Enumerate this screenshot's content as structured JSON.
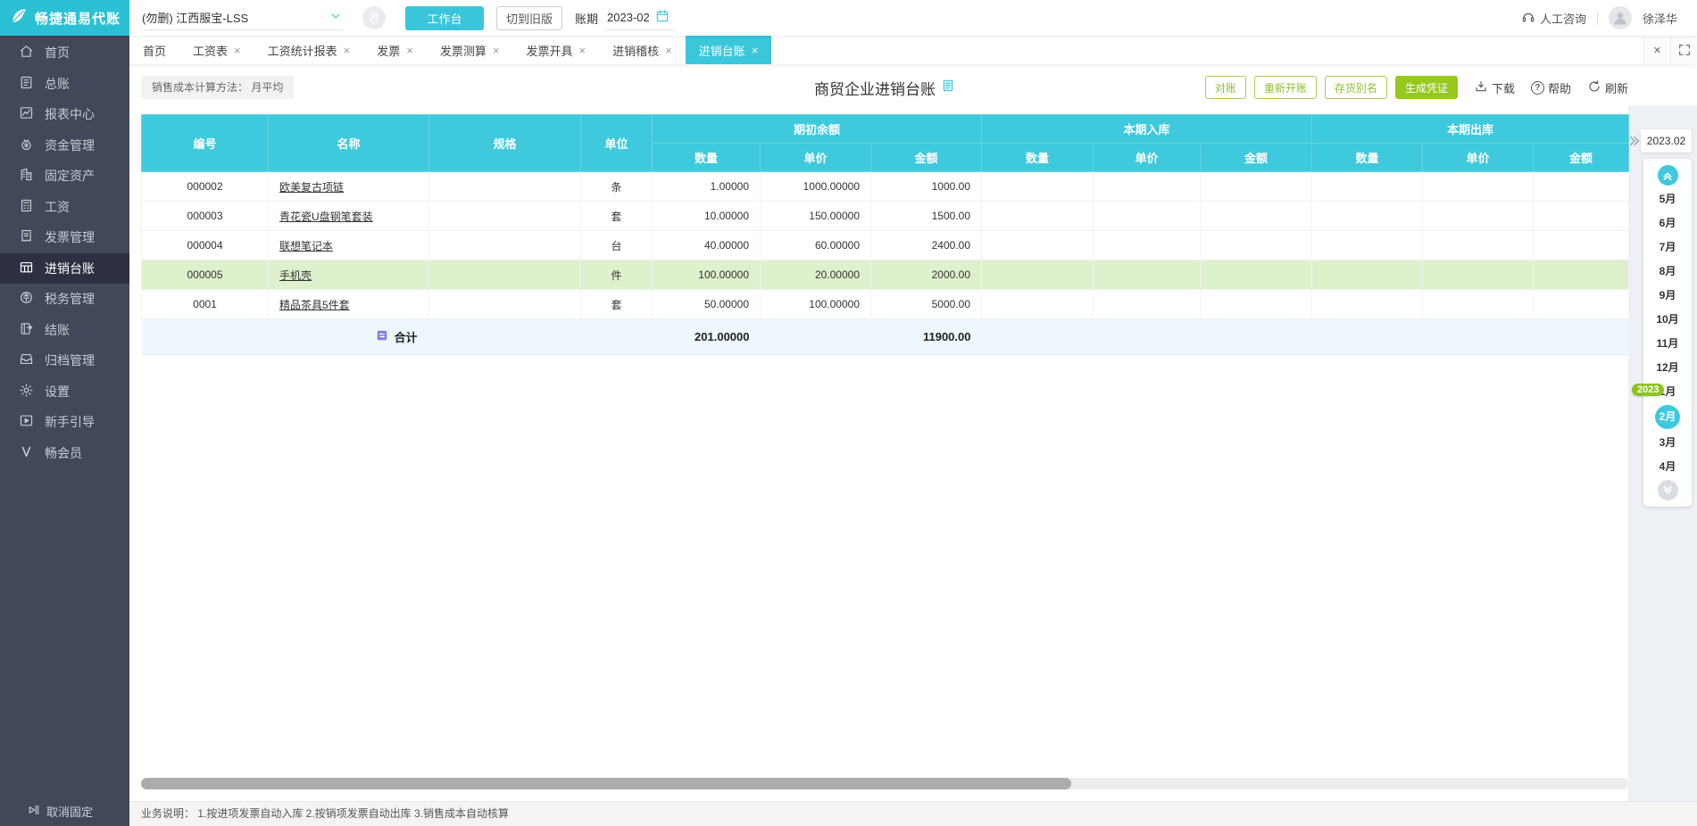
{
  "colors": {
    "accent": "#3bc6da",
    "green": "#97c81e",
    "green_outline": "#8fbf2f",
    "row_highlight": "#def0cc",
    "sidebar_bg": "#424759",
    "sidebar_active": "#2d3040",
    "table_header": "#3ec9dd",
    "total_row_bg": "#edf7fc",
    "year_badge": "#8fc321",
    "total_icon_purple": "#8a7be6"
  },
  "brand": {
    "name": "畅捷通易代账",
    "logo_icon": "feather-logo-icon"
  },
  "topbar": {
    "company_selector": "(勿删) 江西服宝-LSS",
    "notepad_icon": "notepad-icon",
    "workbench_button": "工作台",
    "switch_old_button": "切到旧版",
    "period_label": "账期",
    "period_value": "2023-02",
    "calendar_icon": "calendar-icon",
    "consult_label": "人工咨询",
    "headset_icon": "headset-icon",
    "username": "徐泽华"
  },
  "sidebar": {
    "items": [
      {
        "key": "home",
        "label": "首页",
        "icon": "home-icon",
        "active": false
      },
      {
        "key": "general-ledger",
        "label": "总账",
        "icon": "ledger-icon",
        "active": false
      },
      {
        "key": "report-center",
        "label": "报表中心",
        "icon": "report-icon",
        "active": false
      },
      {
        "key": "funds",
        "label": "资金管理",
        "icon": "funds-icon",
        "active": false
      },
      {
        "key": "fixed-assets",
        "label": "固定资产",
        "icon": "asset-icon",
        "active": false
      },
      {
        "key": "salary",
        "label": "工资",
        "icon": "salary-icon",
        "active": false
      },
      {
        "key": "invoice-mgmt",
        "label": "发票管理",
        "icon": "invoice-icon",
        "active": false
      },
      {
        "key": "purchase-sale-ledger",
        "label": "进销台账",
        "icon": "psledger-icon",
        "active": true
      },
      {
        "key": "tax-mgmt",
        "label": "税务管理",
        "icon": "tax-icon",
        "active": false
      },
      {
        "key": "closing",
        "label": "结账",
        "icon": "closing-icon",
        "active": false
      },
      {
        "key": "archive",
        "label": "归档管理",
        "icon": "archive-icon",
        "active": false
      },
      {
        "key": "settings",
        "label": "设置",
        "icon": "settings-icon",
        "active": false
      },
      {
        "key": "guide",
        "label": "新手引导",
        "icon": "guide-icon",
        "active": false
      },
      {
        "key": "member",
        "label": "畅会员",
        "icon": "member-icon",
        "active": false
      }
    ],
    "unpin_label": "取消固定",
    "unpin_icon": "unpin-icon"
  },
  "tabs": [
    {
      "key": "home",
      "label": "首页",
      "closable": false,
      "active": false
    },
    {
      "key": "salary-sheet",
      "label": "工资表",
      "closable": true,
      "active": false
    },
    {
      "key": "salary-report",
      "label": "工资统计报表",
      "closable": true,
      "active": false
    },
    {
      "key": "invoice",
      "label": "发票",
      "closable": true,
      "active": false
    },
    {
      "key": "invoice-calc",
      "label": "发票测算",
      "closable": true,
      "active": false
    },
    {
      "key": "invoice-issue",
      "label": "发票开具",
      "closable": true,
      "active": false
    },
    {
      "key": "purchase-sale-audit",
      "label": "进销稽核",
      "closable": true,
      "active": false
    },
    {
      "key": "purchase-sale-ledger",
      "label": "进销台账",
      "closable": true,
      "active": true
    }
  ],
  "toolbar": {
    "cost_method_label": "销售成本计算方法：",
    "cost_method_value": "月平均",
    "page_title": "商贸企业进销台账",
    "title_icon": "document-icon",
    "buttons": [
      {
        "key": "reconcile",
        "label": "对账",
        "variant": "outline"
      },
      {
        "key": "reopen",
        "label": "重新开账",
        "variant": "outline"
      },
      {
        "key": "stock-alias",
        "label": "存货别名",
        "variant": "outline"
      },
      {
        "key": "make-voucher",
        "label": "生成凭证",
        "variant": "solid"
      }
    ],
    "download_label": "下载",
    "help_label": "帮助",
    "refresh_label": "刷新"
  },
  "table": {
    "fixed_columns": [
      {
        "key": "code",
        "label": "编号"
      },
      {
        "key": "name",
        "label": "名称"
      },
      {
        "key": "spec",
        "label": "规格"
      },
      {
        "key": "unit",
        "label": "单位"
      }
    ],
    "groups": [
      {
        "key": "begin",
        "label": "期初余额",
        "children": [
          "数量",
          "单价",
          "金额"
        ]
      },
      {
        "key": "in",
        "label": "本期入库",
        "children": [
          "数量",
          "单价",
          "金额"
        ]
      },
      {
        "key": "out",
        "label": "本期出库",
        "children": [
          "数量",
          "单价",
          "金额"
        ]
      }
    ],
    "rows": [
      {
        "code": "000002",
        "name": "欧美复古项链",
        "spec": "",
        "unit": "条",
        "begin_qty": "1.00000",
        "begin_price": "1000.00000",
        "begin_amount": "1000.00",
        "in_qty": "",
        "in_price": "",
        "in_amount": "",
        "out_qty": "",
        "out_price": "",
        "out_amount": "",
        "highlight": false
      },
      {
        "code": "000003",
        "name": "青花瓷U盘钢笔套装",
        "spec": "",
        "unit": "套",
        "begin_qty": "10.00000",
        "begin_price": "150.00000",
        "begin_amount": "1500.00",
        "in_qty": "",
        "in_price": "",
        "in_amount": "",
        "out_qty": "",
        "out_price": "",
        "out_amount": "",
        "highlight": false
      },
      {
        "code": "000004",
        "name": "联想笔记本",
        "spec": "",
        "unit": "台",
        "begin_qty": "40.00000",
        "begin_price": "60.00000",
        "begin_amount": "2400.00",
        "in_qty": "",
        "in_price": "",
        "in_amount": "",
        "out_qty": "",
        "out_price": "",
        "out_amount": "",
        "highlight": true
      },
      {
        "code": "0001",
        "name": "精品茶具5件套",
        "spec": "",
        "unit": "套",
        "begin_qty": "50.00000",
        "begin_price": "100.00000",
        "begin_amount": "5000.00",
        "in_qty": "",
        "in_price": "",
        "in_amount": "",
        "out_qty": "",
        "out_price": "",
        "out_amount": "",
        "highlight": false
      }
    ],
    "rows_note": "row 000005 手机壳 is the highlighted one",
    "total": {
      "label": "合计",
      "icon": "abacus-icon",
      "begin_qty": "201.00000",
      "begin_amount": "11900.00"
    }
  },
  "month_rail": {
    "collapse_icon": "double-chevron-right-icon",
    "period": "2023.02",
    "up_icon": "double-chevron-up-icon",
    "down_icon": "double-chevron-down-icon",
    "year_badge": "2023",
    "year_badge_before_index": 8,
    "months": [
      {
        "label": "5月",
        "active": false
      },
      {
        "label": "6月",
        "active": false
      },
      {
        "label": "7月",
        "active": false
      },
      {
        "label": "8月",
        "active": false
      },
      {
        "label": "9月",
        "active": false
      },
      {
        "label": "10月",
        "active": false
      },
      {
        "label": "11月",
        "active": false
      },
      {
        "label": "12月",
        "active": false
      },
      {
        "label": "1月",
        "active": false
      },
      {
        "label": "2月",
        "active": true
      },
      {
        "label": "3月",
        "active": false
      },
      {
        "label": "4月",
        "active": false
      }
    ]
  },
  "footer": {
    "note": "业务说明： 1.按进项发票自动入库  2.按销项发票自动出库  3.销售成本自动核算"
  }
}
